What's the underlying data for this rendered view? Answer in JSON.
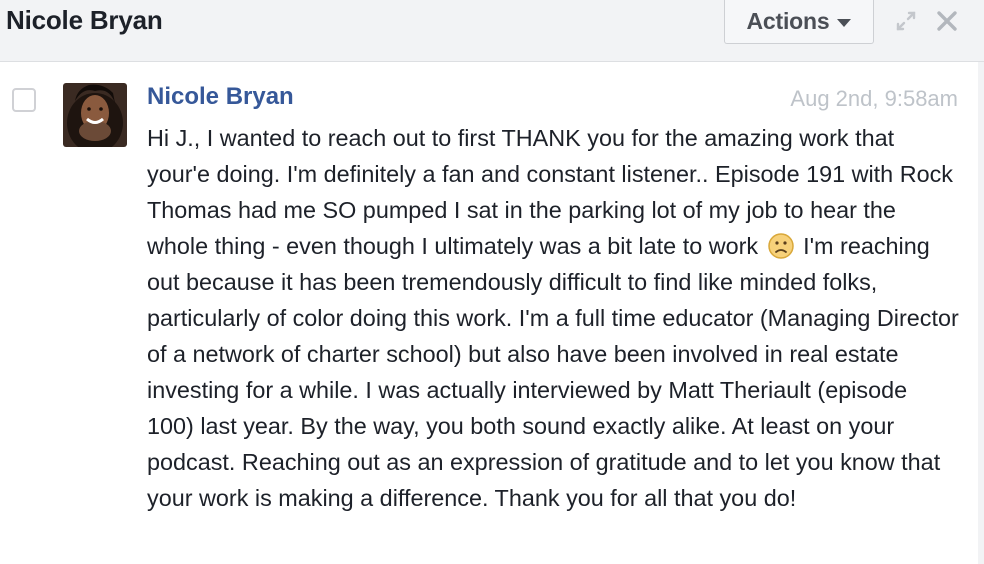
{
  "header": {
    "title": "Nicole Bryan",
    "actions_label": "Actions"
  },
  "icons": {
    "expand": "expand-icon",
    "close": "close-icon",
    "dropdown": "caret-down-icon",
    "emoji": "frown-emoji-icon"
  },
  "message": {
    "sender": "Nicole Bryan",
    "timestamp": "Aug 2nd, 9:58am",
    "text_part1": "Hi J., I wanted to reach out to first THANK you for the amazing work that your'e doing. I'm definitely a fan and constant listener.. Episode 191 with Rock Thomas had me SO pumped I sat in the parking lot of my job to hear the whole thing - even though I ultimately was a bit late to work",
    "text_part2": "I'm reaching out because it has been tremendously difficult to find like minded folks, particularly of color doing this work. I'm a full time educator (Managing Director of a network of charter school) but also have been involved in real estate investing for a while. I was actually interviewed by Matt Theriault (episode 100) last year. By the way, you both sound exactly alike. At least on your podcast. Reaching out as an expression of gratitude and to let you know that your work is making a difference. Thank you for all that you do!"
  },
  "colors": {
    "header_bg": "#f2f3f5",
    "link_blue": "#365899",
    "text": "#1d2129",
    "muted": "#bec3c9"
  }
}
